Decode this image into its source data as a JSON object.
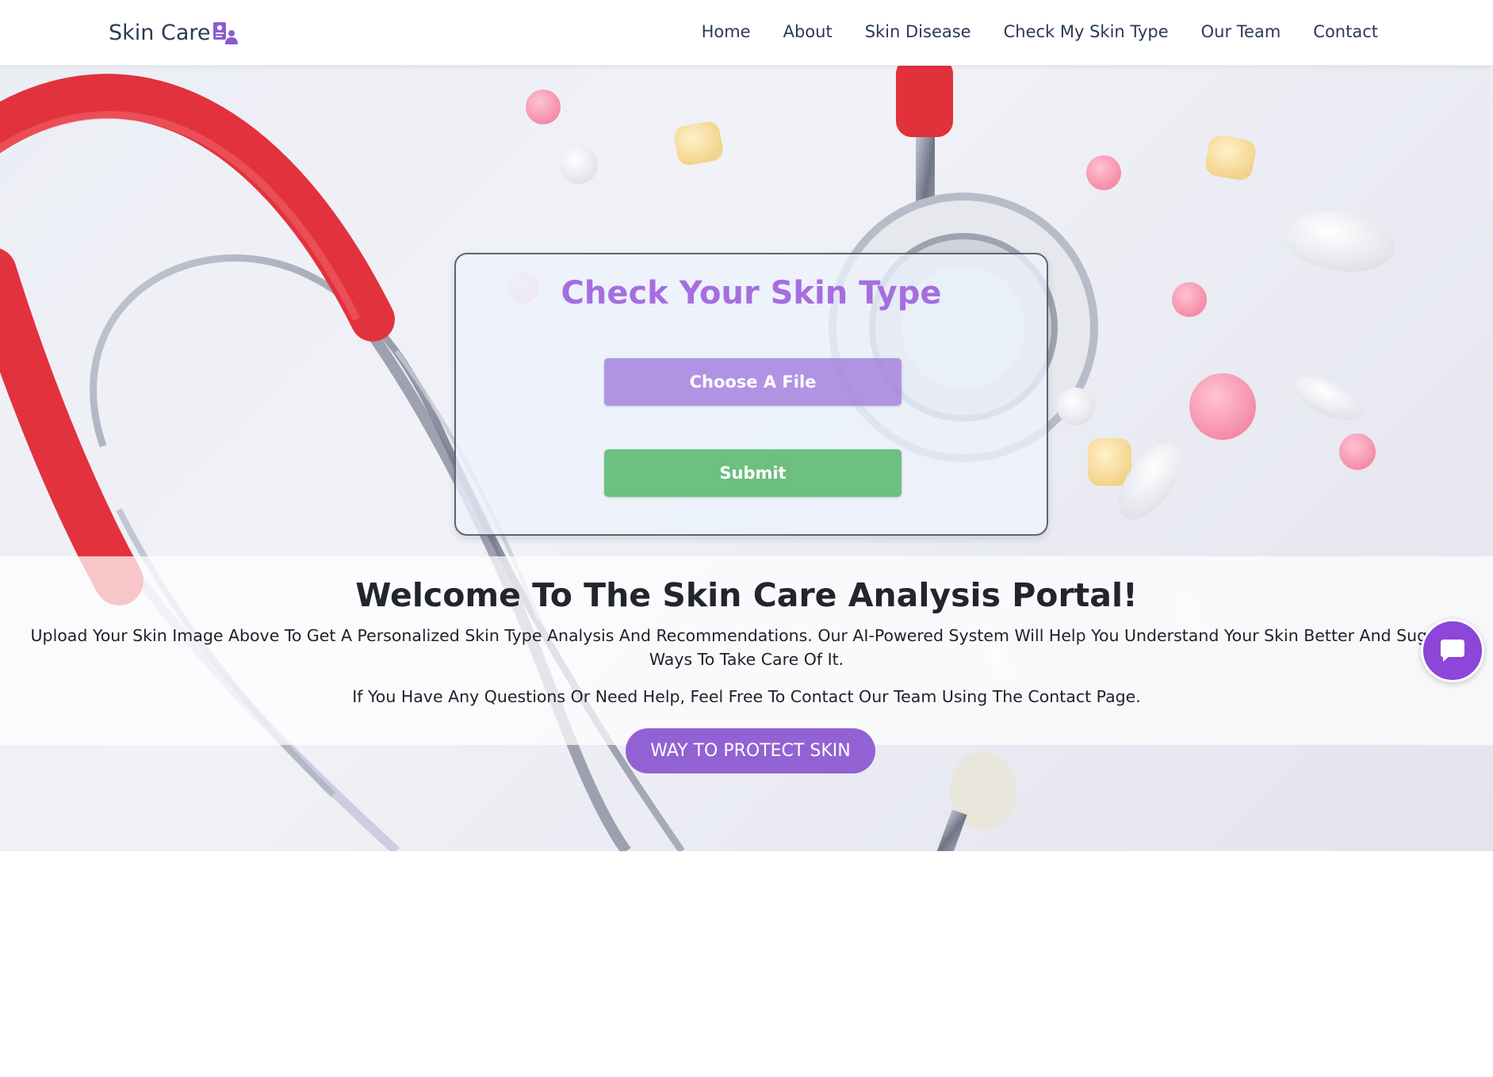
{
  "brand": {
    "name": "Skin Care",
    "icon": "id-card-person-icon"
  },
  "nav": {
    "items": [
      {
        "label": "Home"
      },
      {
        "label": "About"
      },
      {
        "label": "Skin Disease"
      },
      {
        "label": "Check My Skin Type"
      },
      {
        "label": "Our Team"
      },
      {
        "label": "Contact"
      }
    ]
  },
  "hero": {
    "background": "stethoscope-and-pills-photo",
    "card": {
      "title": "Check Your Skin Type",
      "choose_file_label": "Choose A File",
      "submit_label": "Submit"
    },
    "welcome": {
      "title": "Welcome To The Skin Care Analysis Portal!",
      "paragraph1": "Upload Your Skin Image Above To Get A Personalized Skin Type Analysis And Recommendations. Our AI-Powered System Will Help You Understand Your Skin Better And Suggest Ways To Take Care Of It.",
      "paragraph2": "If You Have Any Questions Or Need Help, Feel Free To Contact Our Team Using The Contact Page."
    },
    "cta_label": "WAY TO PROTECT SKIN"
  },
  "chat": {
    "icon": "chat-bubble-icon"
  },
  "colors": {
    "accent_purple": "#a56ee0",
    "button_purple": "#9262d4",
    "submit_green": "#50b464",
    "nav_text": "#2b3a55",
    "chat_purple": "#8c46d8"
  }
}
